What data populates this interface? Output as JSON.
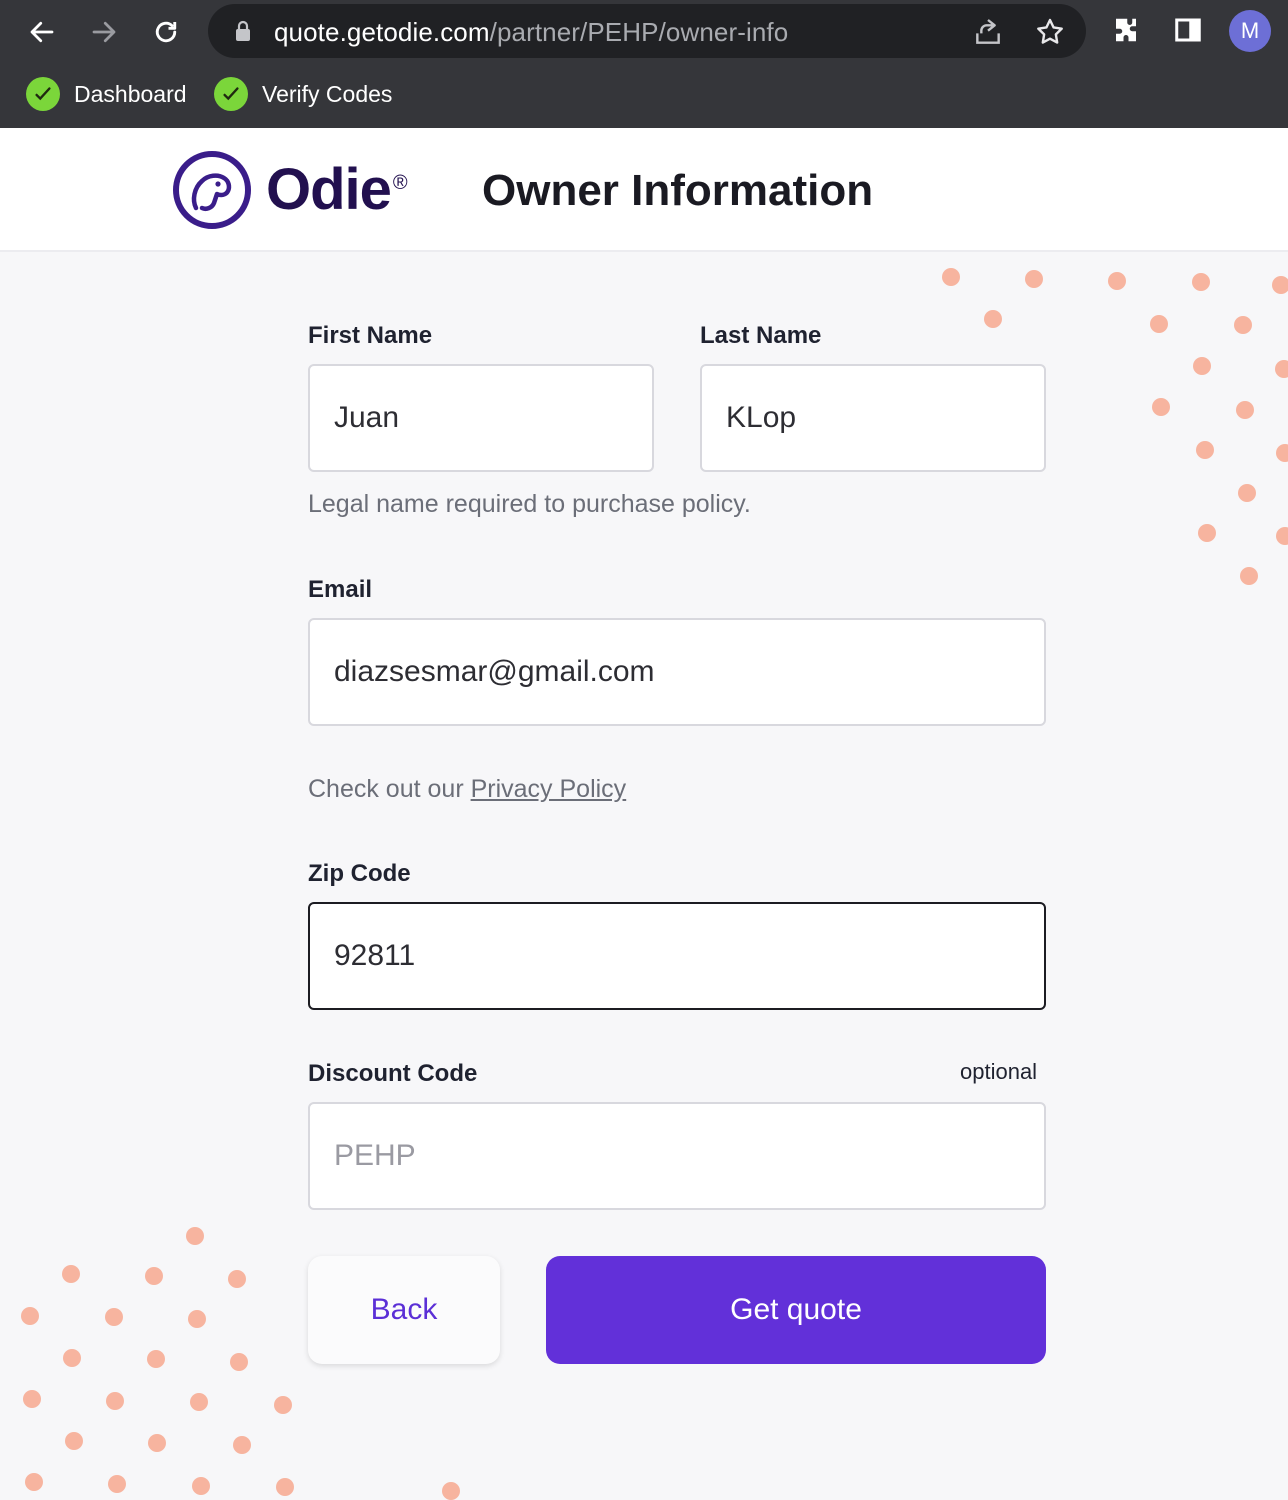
{
  "browser": {
    "url_host": "quote.getodie.com",
    "url_path": "/partner/PEHP/owner-info",
    "profile_initial": "M",
    "bookmarks": [
      {
        "label": "Dashboard",
        "icon": "check-pencil-icon"
      },
      {
        "label": "Verify Codes",
        "icon": "check-pencil-icon"
      }
    ]
  },
  "header": {
    "brand": "Odie",
    "brand_mark": "®",
    "title": "Owner Information"
  },
  "form": {
    "first_name": {
      "label": "First Name",
      "value": "Juan"
    },
    "last_name": {
      "label": "Last Name",
      "value": "KLop"
    },
    "name_helper": "Legal name required to purchase policy.",
    "email": {
      "label": "Email",
      "value": "diazsesmar@gmail.com"
    },
    "privacy_prefix": "Check out our ",
    "privacy_link": "Privacy Policy",
    "zip": {
      "label": "Zip Code",
      "value": "92811"
    },
    "discount": {
      "label": "Discount Code",
      "optional": "optional",
      "placeholder": "PEHP"
    },
    "back_label": "Back",
    "submit_label": "Get quote"
  },
  "colors": {
    "accent": "#6230d9",
    "brand_dark": "#22104f",
    "dots": "#f7b49f",
    "chrome": "#35363a"
  }
}
